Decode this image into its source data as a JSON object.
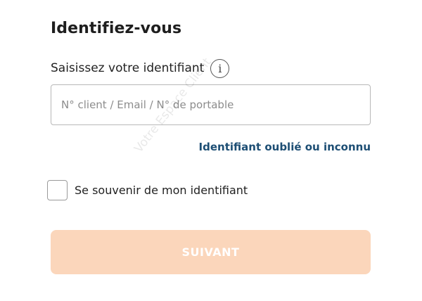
{
  "form": {
    "title": "Identifiez-vous",
    "identifier_label": "Saisissez votre identifiant",
    "info_icon": "info-icon",
    "info_glyph": "i",
    "identifier_value": "",
    "identifier_placeholder": "N° client / Email / N° de portable",
    "forgot_link": "Identifiant oublié ou inconnu",
    "remember_label": "Se souvenir de mon identifiant",
    "remember_checked": false,
    "submit_label": "SUIVANT"
  },
  "watermark": {
    "text": "Votre Espace Client"
  },
  "colors": {
    "link": "#1d4e74",
    "submit_background": "#fbd6bb",
    "submit_text": "#ffffff",
    "input_border": "#b8b8b8"
  }
}
